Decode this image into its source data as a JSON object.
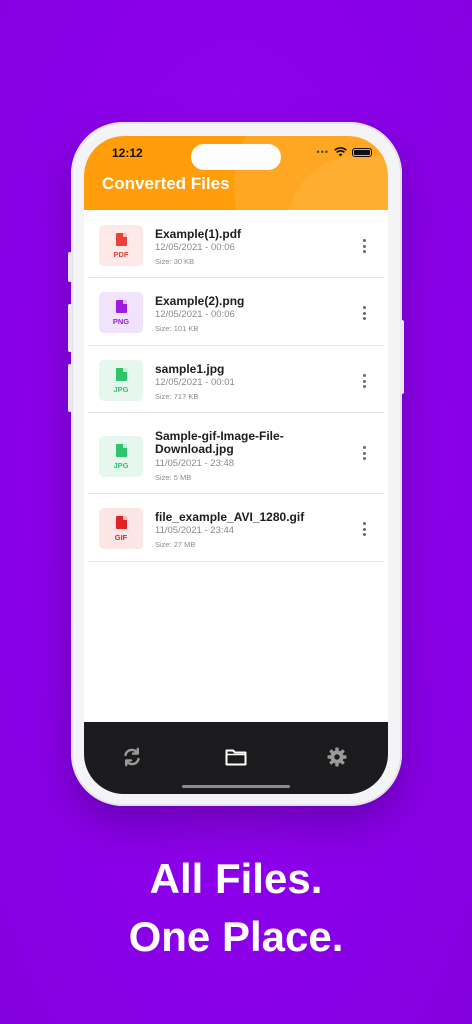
{
  "status_bar": {
    "time": "12:12"
  },
  "header": {
    "title": "Converted Files"
  },
  "files": [
    {
      "name": "Example(1).pdf",
      "date": "12/05/2021 - 00:06",
      "size": "Size: 30 KB",
      "type": "PDF",
      "color": "#e8423b",
      "bg": "#fde9e7"
    },
    {
      "name": "Example(2).png",
      "date": "12/05/2021 - 00:06",
      "size": "Size: 101 KB",
      "type": "PNG",
      "color": "#9b1de0",
      "bg": "#f1e3fb"
    },
    {
      "name": "sample1.jpg",
      "date": "12/05/2021 - 00:01",
      "size": "Size: 717 KB",
      "type": "JPG",
      "color": "#2fc46a",
      "bg": "#e6f7ed"
    },
    {
      "name": "Sample-gif-Image-File-Download.jpg",
      "date": "11/05/2021 - 23:48",
      "size": "Size: 5 MB",
      "type": "JPG",
      "color": "#2fc46a",
      "bg": "#e6f7ed"
    },
    {
      "name": "file_example_AVI_1280.gif",
      "date": "11/05/2021 - 23:44",
      "size": "Size: 27 MB",
      "type": "GIF",
      "color": "#e02424",
      "bg": "#fbe5e5"
    }
  ],
  "tabbar": {
    "icons": [
      "refresh-icon",
      "folder-icon",
      "settings-icon"
    ]
  },
  "tagline": {
    "line1": "All Files.",
    "line2": "One Place."
  },
  "colors": {
    "background": "#8a00e8",
    "header": "#ff9d0a",
    "tabbar": "#1b1b1d"
  }
}
